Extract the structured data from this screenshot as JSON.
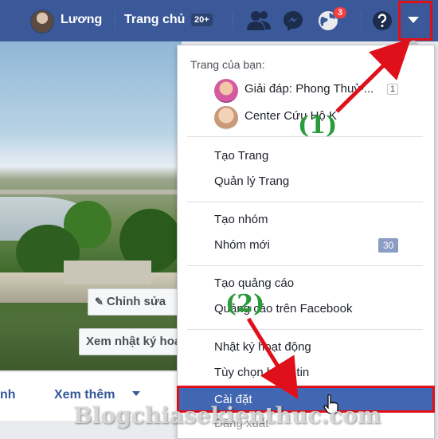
{
  "topbar": {
    "user_name": "Lương",
    "home_label": "Trang chủ",
    "home_badge": "20+",
    "notifications_count": "3",
    "icons": [
      "friends-icon",
      "messenger-icon",
      "notifications-icon",
      "help-icon",
      "dropdown-arrow-icon"
    ]
  },
  "cover": {
    "edit_button": "Chỉnh sửa",
    "activity_button": "Xem nhật ký hoạt"
  },
  "profile_nav": {
    "left_fragment": "nh",
    "more_label": "Xem thêm"
  },
  "dropdown": {
    "pages_title": "Trang của bạn:",
    "pages": [
      {
        "name": "Giải đáp: Phong Thuỷ-...",
        "count": "1"
      },
      {
        "name": "Center Cứu Hộ K"
      }
    ],
    "page_items": [
      "Tạo Trang",
      "Quản lý Trang"
    ],
    "group_items": [
      {
        "label": "Tạo nhóm"
      },
      {
        "label": "Nhóm mới",
        "count": "30"
      }
    ],
    "ad_items": [
      "Tạo quảng cáo",
      "Quảng cáo trên Facebook"
    ],
    "activity_items": [
      "Nhật ký hoạt động",
      "Tùy chọn bảng tin"
    ],
    "settings": "Cài đặt",
    "logout": "Đăng xuất"
  },
  "annotations": {
    "step1": "(1)",
    "step2": "(2)",
    "colors": {
      "arrow": "#e0101a",
      "label": "#2a9a3a",
      "topbar": "#3b5998",
      "highlight": "#4267b2"
    }
  },
  "watermark": "Blogchiasekienthuc.com"
}
